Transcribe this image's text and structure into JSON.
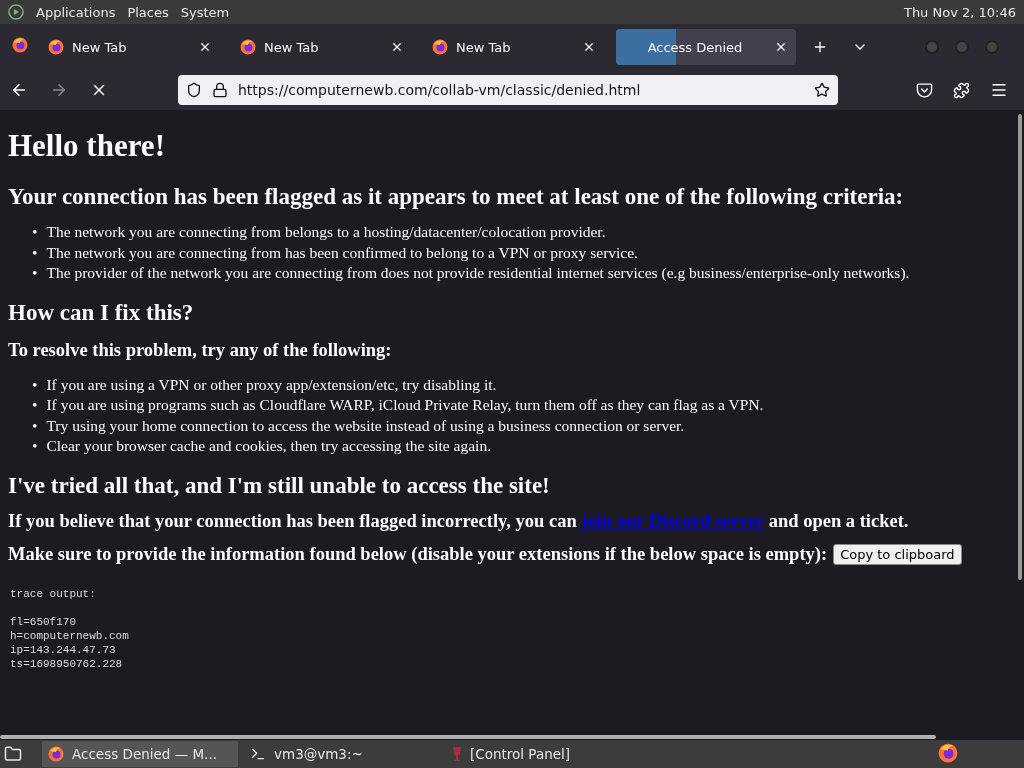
{
  "top_panel": {
    "menus": [
      "Applications",
      "Places",
      "System"
    ],
    "clock": "Thu Nov  2, 10:46"
  },
  "tabs": [
    {
      "label": "New Tab",
      "selected": false,
      "loading": false
    },
    {
      "label": "New Tab",
      "selected": false,
      "loading": false
    },
    {
      "label": "New Tab",
      "selected": false,
      "loading": false
    },
    {
      "label": "Access Denied",
      "selected": true,
      "loading": true
    }
  ],
  "address_bar": {
    "url": "https://computernewb.com/collab-vm/classic/denied.html"
  },
  "page": {
    "title": "Hello there!",
    "sections": [
      {
        "heading": "Your connection has been flagged as it appears to meet at least one of the following criteria:",
        "kind": "h2",
        "bullet": "•",
        "items": [
          "The network you are connecting from belongs to a hosting/datacenter/colocation provider.",
          "The network you are connecting from has been confirmed to belong to a VPN or proxy service.",
          "The provider of the network you are connecting from does not provide residential internet services (e.g business/enterprise-only networks)."
        ]
      },
      {
        "heading": "How can I fix this?",
        "kind": "h2"
      },
      {
        "heading": "To resolve this problem, try any of the following:",
        "kind": "h3",
        "bullet": "•",
        "items": [
          "If you are using a VPN or other proxy app/extension/etc, try disabling it.",
          "If you are using programs such as Cloudflare WARP, iCloud Private Relay, turn them off as they can flag as a VPN.",
          "Try using your home connection to access the website instead of using a business connection or server.",
          "Clear your browser cache and cookies, then try accessing the site again."
        ]
      },
      {
        "heading": "I've tried all that, and I'm still unable to access the site!",
        "kind": "h2"
      }
    ],
    "ticket": {
      "before": "If you believe that your connection has been flagged incorrectly, you can",
      "link": "join our Discord server",
      "after": "and open a ticket."
    },
    "info": {
      "text": "Make sure to provide the information found below (disable your extensions if the below space is empty):",
      "button": "Copy to clipboard"
    },
    "trace": {
      "header": "trace output:",
      "lines": [
        "fl=650f170",
        "h=computernewb.com",
        "ip=143.244.47.73",
        "ts=1698950762.228"
      ]
    }
  },
  "taskbar": [
    {
      "label": "Access Denied — M...",
      "selected": true,
      "kind": "browser"
    },
    {
      "label": "vm3@vm3:~",
      "selected": false,
      "kind": "terminal"
    },
    {
      "label": "[Control Panel]",
      "selected": false,
      "kind": "wine"
    }
  ]
}
